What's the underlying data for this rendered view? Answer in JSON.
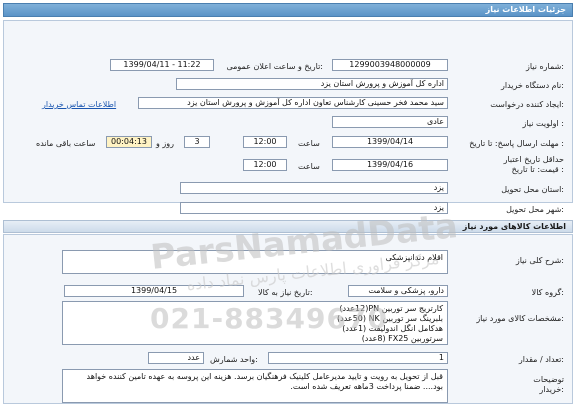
{
  "window": {
    "title": "جزئیات اطلاعات نیاز"
  },
  "info": {
    "need_number_label": "شماره نیاز:",
    "need_number": "1299003948000009",
    "announce_label": "تاریخ و ساعت اعلان عمومی:",
    "announce_value": "1399/04/11 - 11:22",
    "buyer_org_label": "نام دستگاه خریدار:",
    "buyer_org": "اداره کل آموزش و پرورش استان یزد",
    "creator_label": "ایجاد کننده درخواست:",
    "creator": "سید محمد فخر حسینی کارشناس تعاون اداره کل آموزش و پرورش استان یزد",
    "contact_link": "اطلاعات تماس خریدار",
    "priority_label": "اولویت نیاز :",
    "priority": "عادی",
    "deadline_label": "مهلت ارسال پاسخ: تا تاریخ :",
    "deadline_date": "1399/04/14",
    "time_label": "ساعت",
    "deadline_time": "12:00",
    "days_value": "3",
    "days_label": "روز و",
    "remaining_value": "00:04:13",
    "remaining_label": "ساعت باقی مانده",
    "validity_label_1": "حداقل تاریخ اعتبار",
    "validity_label_2": "قیمت: تا تاریخ :",
    "validity_date": "1399/04/16",
    "validity_time": "12:00",
    "province_label": "استان محل تحویل:",
    "province": "یزد",
    "city_label": "شهر محل تحویل:",
    "city": "یزد"
  },
  "goods": {
    "header": "اطلاعات کالاهای مورد نیاز",
    "summary_label": "شرح کلی نیاز:",
    "summary": "اقلام دندانپزشکی",
    "group_label": "گروه کالا:",
    "group": "دارو، پزشکی و سلامت",
    "need_date_label": "تاریخ نیاز به کالا:",
    "need_date": "1399/04/15",
    "specs_label": "مشخصات کالای مورد نیاز:",
    "specs_lines": [
      "کارتریج سر توربین PN(12عدد)",
      "بلبرینگ سر توربین NK (50عدد)",
      "هدکامل انگل اندولیفت (1عدد)",
      "سرتوربین FX25 (8عدد)"
    ],
    "qty_label": "تعداد / مقدار:",
    "qty": "1",
    "unit_label": "واحد شمارش:",
    "unit": "عدد",
    "buyer_notes_label_1": "توضیحات",
    "buyer_notes_label_2": "خریدار:",
    "buyer_notes": "قبل از تحویل به رویت و تایید مدیرعامل کلینیک فرهنگیان برسد. هزینه این پروسه به عهده تامین کننده خواهد بود.... ضمنا پرداخت 3ماهه تعریف شده است."
  },
  "watermark": {
    "brand": "ParsNamadData",
    "slogan": "مرکز فراوری اطلاعات پارس نماد داده",
    "phone": "021-88349670"
  }
}
